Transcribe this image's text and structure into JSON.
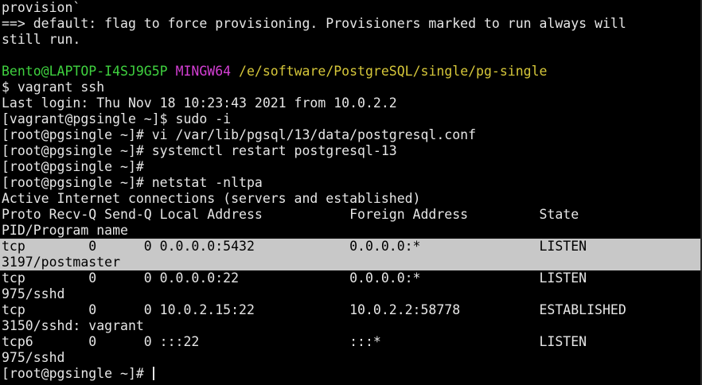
{
  "colors": {
    "background": "#000000",
    "text": "#e6e6e6",
    "user_host": "#3fd13f",
    "msystem": "#d43fd4",
    "path": "#d6c73a",
    "highlight_background": "#c8c8c8",
    "highlight_text": "#000000"
  },
  "terminal": {
    "lines": [
      {
        "text": "provision`"
      },
      {
        "text": "==> default: flag to force provisioning. Provisioners marked to run always will"
      },
      {
        "text": "still run."
      },
      {
        "text": ""
      },
      {
        "prompt": {
          "user_host": "Bento@LAPTOP-I4SJ9G5P",
          "msystem": "MINGW64",
          "path": "/e/software/PostgreSQL/single/pg-single"
        }
      },
      {
        "text": "$ vagrant ssh"
      },
      {
        "text": "Last login: Thu Nov 18 10:23:43 2021 from 10.0.2.2"
      },
      {
        "text": "[vagrant@pgsingle ~]$ sudo -i"
      },
      {
        "text": "[root@pgsingle ~]# vi /var/lib/pgsql/13/data/postgresql.conf"
      },
      {
        "text": "[root@pgsingle ~]# systemctl restart postgresql-13"
      },
      {
        "text": "[root@pgsingle ~]#"
      },
      {
        "text": "[root@pgsingle ~]# netstat -nltpa"
      },
      {
        "text": "Active Internet connections (servers and established)"
      },
      {
        "text": "Proto Recv-Q Send-Q Local Address           Foreign Address         State"
      },
      {
        "text": "PID/Program name"
      },
      {
        "text": "tcp        0      0 0.0.0.0:5432            0.0.0.0:*               LISTEN",
        "highlight": true
      },
      {
        "text": "3197/postmaster",
        "highlight": true
      },
      {
        "text": "tcp        0      0 0.0.0.0:22              0.0.0.0:*               LISTEN"
      },
      {
        "text": "975/sshd"
      },
      {
        "text": "tcp        0      0 10.0.2.15:22            10.0.2.2:58778          ESTABLISHED"
      },
      {
        "text": "3150/sshd: vagrant"
      },
      {
        "text": "tcp6       0      0 :::22                   :::*                    LISTEN"
      },
      {
        "text": "975/sshd"
      },
      {
        "text": "[root@pgsingle ~]# ",
        "cursor": true
      }
    ]
  }
}
